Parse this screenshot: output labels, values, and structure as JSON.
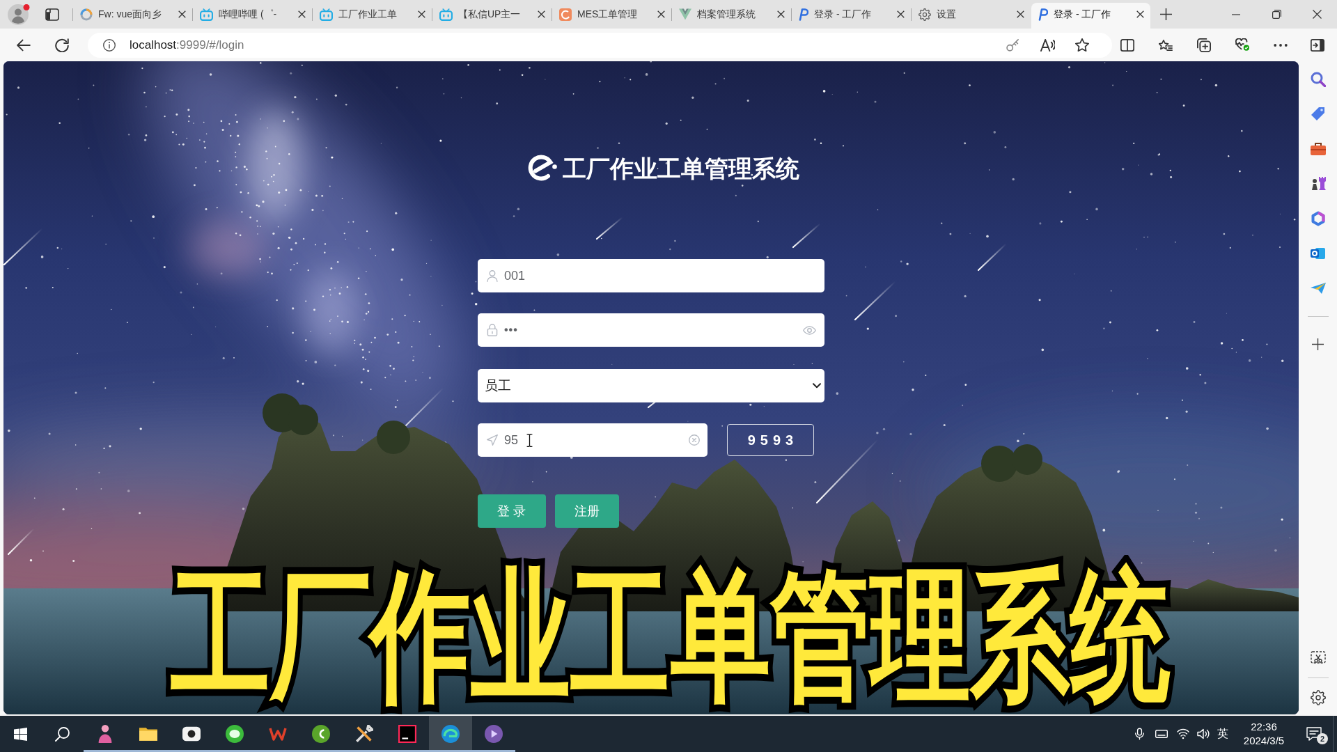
{
  "browser": {
    "tabs": [
      {
        "title": "Fw: vue面向乡",
        "kind": "ring",
        "selected": false
      },
      {
        "title": "哔哩哔哩 (゜-",
        "kind": "tv",
        "selected": false
      },
      {
        "title": "工厂作业工单",
        "kind": "tv",
        "selected": false
      },
      {
        "title": "【私信UP主一",
        "kind": "tv",
        "selected": false
      },
      {
        "title": "MES工单管理",
        "kind": "swirl",
        "selected": false
      },
      {
        "title": "档案管理系统",
        "kind": "triangle",
        "selected": false
      },
      {
        "title": "登录 - 工厂作",
        "kind": "script",
        "selected": false
      },
      {
        "title": "设置",
        "kind": "settings",
        "selected": false
      },
      {
        "title": "登录 - 工厂作",
        "kind": "script",
        "selected": true
      }
    ],
    "address": {
      "host": "localhost",
      "rest": ":9999/#/login"
    }
  },
  "login": {
    "title": "工厂作业工单管理系统",
    "username": {
      "value": "001"
    },
    "password": {
      "value": "•••"
    },
    "role": {
      "value": "员工"
    },
    "captcha": {
      "value": "95",
      "code": "9593"
    },
    "buttons": [
      {
        "label": "登 录"
      },
      {
        "label": "注册"
      }
    ]
  },
  "taskbar": {
    "apps": [
      {
        "kind": "person",
        "running": true,
        "selected": false
      },
      {
        "kind": "folder",
        "running": true,
        "selected": false
      },
      {
        "kind": "camera",
        "running": true,
        "selected": false
      },
      {
        "kind": "chat",
        "running": true,
        "selected": false
      },
      {
        "kind": "zigzag",
        "running": true,
        "selected": false
      },
      {
        "kind": "swirl",
        "running": true,
        "selected": false
      },
      {
        "kind": "tools",
        "running": true,
        "selected": false
      },
      {
        "kind": "ide",
        "running": true,
        "selected": false
      },
      {
        "kind": "browser",
        "running": true,
        "selected": true
      },
      {
        "kind": "media",
        "running": true,
        "selected": false
      }
    ],
    "input_method": "英",
    "time": "22:36",
    "date": "2024/3/5",
    "notification_count": "2"
  },
  "video_caption": "工厂作业工单管理系统"
}
